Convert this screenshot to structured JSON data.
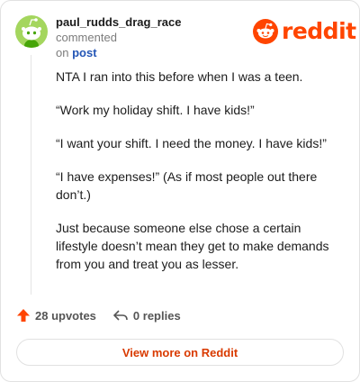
{
  "header": {
    "username": "paul_rudds_drag_race",
    "action_text": "commented",
    "on_text": "on",
    "post_link": "post",
    "brand": "reddit"
  },
  "comment": {
    "paragraphs": [
      "NTA I ran into this before when I was a teen.",
      "“Work my holiday shift. I have kids!”",
      "“I want your shift. I need the money. I have kids!”",
      "“I have expenses!” (As if most people out there don’t.)",
      "Just because someone else chose a certain lifestyle doesn’t mean they get to make demands from you and treat you as lesser."
    ]
  },
  "actions": {
    "upvotes": "28 upvotes",
    "replies": "0 replies"
  },
  "footer": {
    "view_more": "View more on Reddit"
  },
  "colors": {
    "brand": "#ff4500",
    "avatar_bg": "#a4d65e",
    "link": "#2456b6",
    "view_more": "#d93a00"
  },
  "icons": [
    "snoo-avatar-icon",
    "reddit-logo-icon",
    "upvote-arrow-icon",
    "reply-arrow-icon"
  ]
}
